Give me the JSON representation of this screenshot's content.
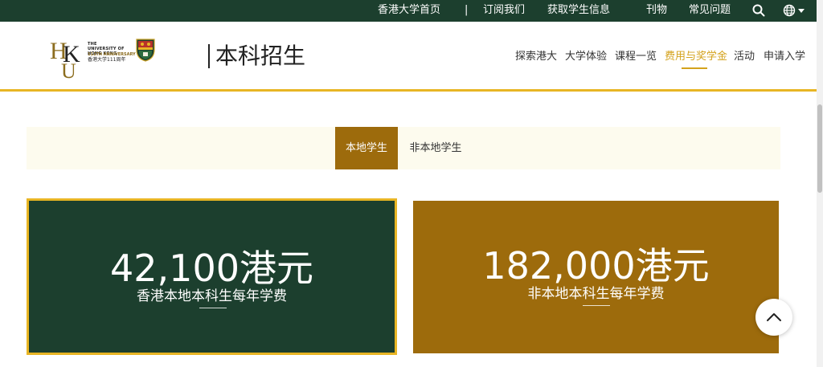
{
  "topbar": {
    "links": [
      "香港大学首页",
      "订阅我们",
      "获取学生信息",
      "刊物",
      "常见问题"
    ],
    "separator": "|"
  },
  "logo": {
    "university_en": "THE UNIVERSITY OF HONG KONG",
    "anniversary": "111TH ANNIVERSARY",
    "university_cn": "香港大学111周年"
  },
  "header": {
    "site_title": "本科招生",
    "nav": [
      "探索港大",
      "大学体验",
      "课程一览",
      "费用与奖学金",
      "活动",
      "申请入学"
    ],
    "active_nav": "费用与奖学金"
  },
  "tabs": {
    "items": [
      "本地学生",
      "非本地学生"
    ],
    "active": "本地学生"
  },
  "fees": {
    "local": {
      "amount": "42,100港元",
      "caption": "香港本地本科生每年学费"
    },
    "nonlocal": {
      "amount": "182,000港元",
      "caption": "非本地本科生每年学费"
    }
  },
  "colors": {
    "dark_green": "#1c3f2e",
    "gold": "#e8b524",
    "bronze": "#9d6b0c",
    "accent_text": "#d4a21c"
  },
  "icons": {
    "search": "search-icon",
    "language": "globe-icon",
    "back_to_top": "chevron-up-icon"
  }
}
